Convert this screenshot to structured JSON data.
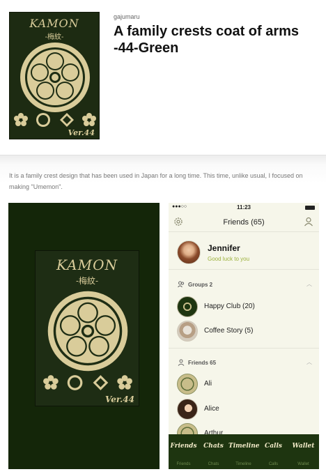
{
  "app": {
    "author": "gajumaru",
    "title": "A family crests coat of arms -44-Green",
    "description": "It is a family crest design that has been used in Japan for a long time. This time, unlike usual, I focused on making \"Umemon\"."
  },
  "crest": {
    "brand": "KAMON",
    "subtitle": "-梅紋-",
    "version": "Ver.44"
  },
  "colors": {
    "dark_green": "#142609",
    "panel_green": "#1e2d14",
    "gold": "#d9cc9a",
    "accent_green": "#9bb03a"
  },
  "phone": {
    "signal": "●●●○○",
    "clock": "11:23",
    "nav_title": "Friends (65)",
    "left_icon": "gear-icon",
    "right_icon": "person-icon",
    "me": {
      "name": "Jennifer",
      "status": "Good luck to you"
    },
    "groups_header": "Groups 2",
    "groups": [
      {
        "name": "Happy Club (20)"
      },
      {
        "name": "Coffee Story (5)"
      }
    ],
    "friends_header": "Friends 65",
    "friends": [
      {
        "name": "Ali"
      },
      {
        "name": "Alice"
      },
      {
        "name": "Arthur"
      }
    ],
    "tabs": [
      {
        "label": "Friends",
        "sub": "Friends"
      },
      {
        "label": "Chats",
        "sub": "Chats"
      },
      {
        "label": "Timeline",
        "sub": "Timeline"
      },
      {
        "label": "Calls",
        "sub": "Calls"
      },
      {
        "label": "Wallet",
        "sub": "Wallet"
      }
    ]
  }
}
